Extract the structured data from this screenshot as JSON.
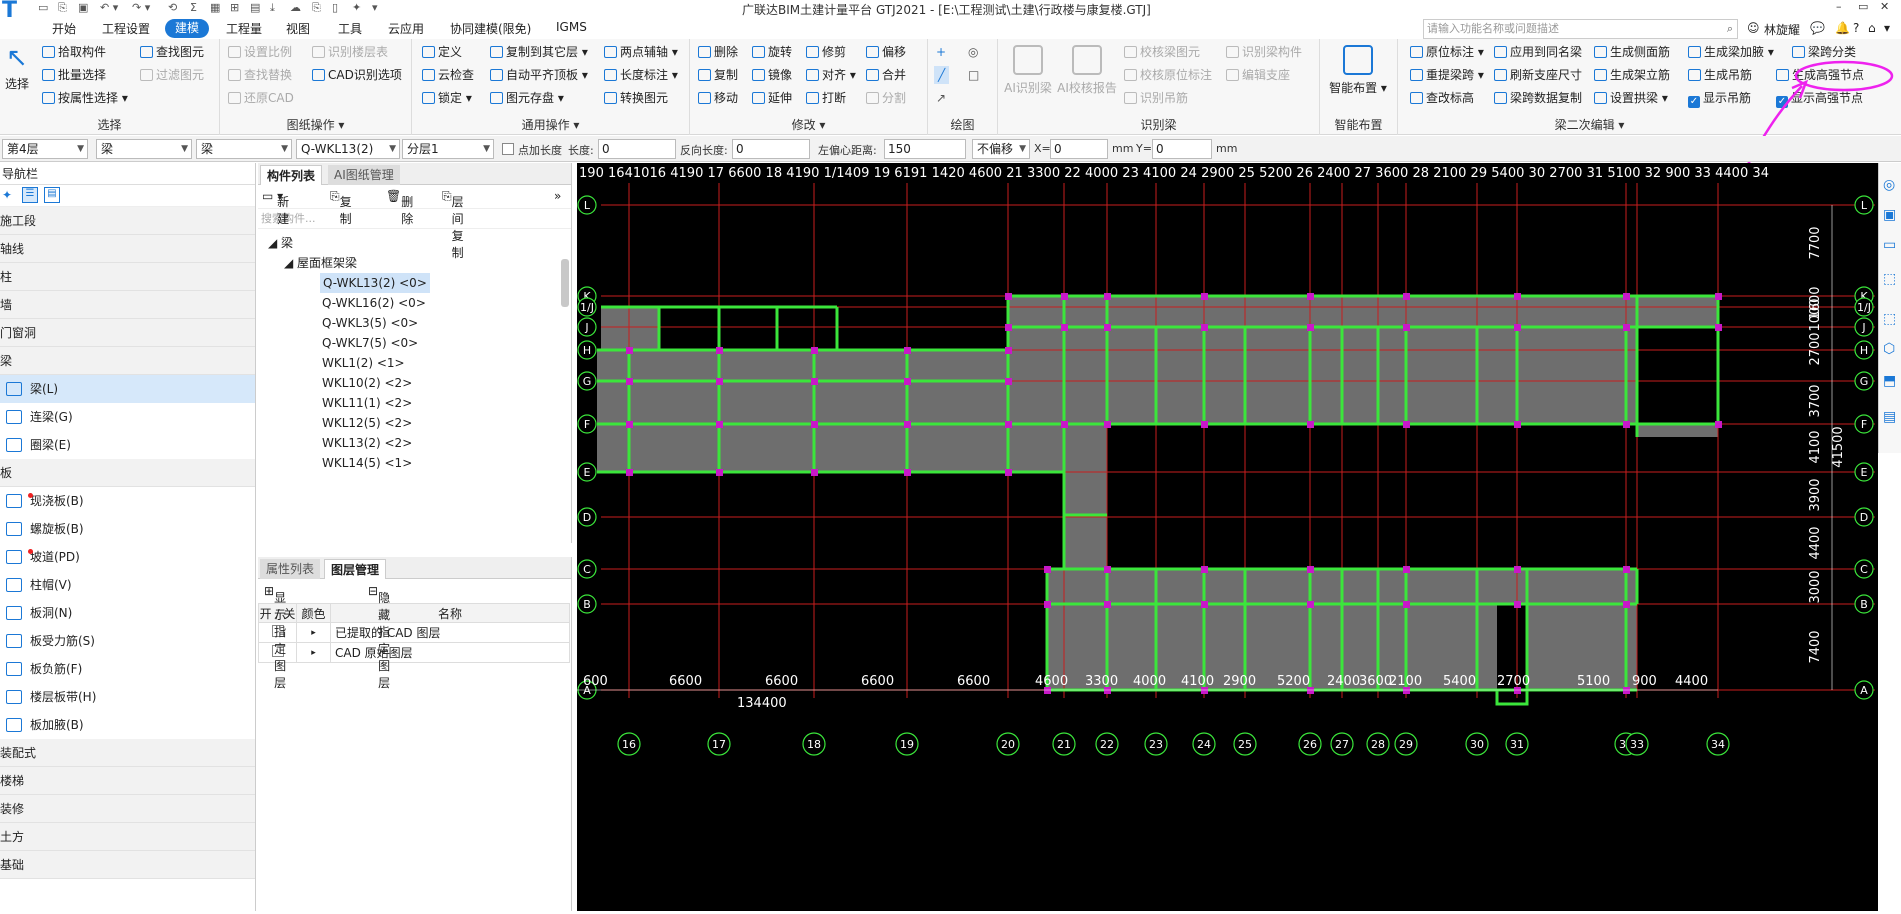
{
  "titlebar": {
    "title": "广联达BIM土建计量平台 GTJ2021 - [E:\\工程测试\\土建\\行政楼与康复楼.GTJ]",
    "logo": "T",
    "quick_access": [
      "↶",
      "↷",
      "Σ",
      "▭",
      "⊞",
      "▦",
      "⤓",
      "⎘"
    ],
    "win_controls": [
      "–",
      "▭",
      "✕"
    ]
  },
  "menubar": {
    "items": [
      "开始",
      "工程设置",
      "建模",
      "工程量",
      "视图",
      "工具",
      "云应用",
      "协同建模(限免)",
      "IGMS"
    ],
    "active": "建模",
    "search_placeholder": "请输入功能名称或问题描述",
    "user": "林旋耀",
    "right_icons": [
      "💬",
      "🔔",
      "?",
      "⌂",
      "▾"
    ]
  },
  "ribbon": {
    "groups": [
      {
        "title": "选择",
        "big": "选择",
        "buttons": [
          "拾取构件",
          "批量选择",
          "按属性选择",
          "查找图元",
          "过滤图元"
        ]
      },
      {
        "title": "图纸操作 ▾",
        "buttons": [
          "设置比例",
          "识别楼层表",
          "查找替换",
          "CAD识别选项",
          "还原CAD"
        ]
      },
      {
        "title": "通用操作 ▾",
        "buttons": [
          "定义",
          "复制到其它层",
          "两点辅轴",
          "云检查",
          "自动平齐顶板",
          "长度标注",
          "锁定",
          "图元存盘",
          "转换图元"
        ]
      },
      {
        "title": "修改 ▾",
        "buttons": [
          "删除",
          "旋转",
          "修剪",
          "偏移",
          "复制",
          "镜像",
          "对齐",
          "合并",
          "移动",
          "延伸",
          "打断",
          "分割"
        ]
      },
      {
        "title": "绘图",
        "buttons": [
          "+",
          "◎",
          "╱",
          "□",
          "↗"
        ]
      },
      {
        "title": "识别梁",
        "big_buttons": [
          "AI识别梁",
          "AI校核报告"
        ],
        "buttons": [
          "校核梁图元",
          "识别梁构件",
          "校核原位标注",
          "编辑支座",
          "识别吊筋"
        ]
      },
      {
        "title": "智能布置",
        "big": "智能布置"
      },
      {
        "title": "梁二次编辑 ▾",
        "buttons": [
          "原位标注",
          "应用到同名梁",
          "生成侧面筋",
          "生成梁加腋",
          "梁跨分类",
          "重提梁跨",
          "刷新支座尺寸",
          "生成架立筋",
          "生成吊筋",
          "生成高强节点",
          "查改标高",
          "梁跨数据复制",
          "设置拱梁",
          "显示吊筋",
          "显示高强节点"
        ]
      }
    ]
  },
  "toolrow": {
    "floor": "第4层",
    "type1": "梁",
    "type2": "梁",
    "component": "Q-WKL13(2)",
    "layer": "分层1",
    "point_length_label": "点加长度",
    "length_label": "长度:",
    "length_value": "0",
    "reverse_length_label": "反向长度:",
    "reverse_length_value": "0",
    "left_offset_label": "左偏心距离:",
    "left_offset_value": "150",
    "offset_mode": "不偏移",
    "x_label": "X=",
    "x_value": "0",
    "mm1": "mm",
    "y_label": "Y=",
    "y_value": "0",
    "mm2": "mm"
  },
  "nav": {
    "header": "导航栏",
    "categories_top": [
      "施工段",
      "轴线",
      "柱",
      "墙",
      "门窗洞"
    ],
    "beam_cat": "梁",
    "beam_items": [
      {
        "label": "梁(L)",
        "selected": true
      },
      {
        "label": "连梁(G)"
      },
      {
        "label": "圈梁(E)"
      }
    ],
    "slab_cat": "板",
    "slab_items": [
      {
        "label": "现浇板(B)",
        "dot": true
      },
      {
        "label": "螺旋板(B)"
      },
      {
        "label": "坡道(PD)",
        "dot": true
      },
      {
        "label": "柱帽(V)"
      },
      {
        "label": "板洞(N)"
      },
      {
        "label": "板受力筋(S)"
      },
      {
        "label": "板负筋(F)"
      },
      {
        "label": "楼层板带(H)"
      },
      {
        "label": "板加腋(B)"
      }
    ],
    "categories_bottom": [
      "装配式",
      "楼梯",
      "装修",
      "土方",
      "基础"
    ]
  },
  "components": {
    "tabs": [
      "构件列表",
      "AI图纸管理"
    ],
    "toolbar": [
      "新建",
      "复制",
      "删除",
      "层间复制"
    ],
    "search_placeholder": "搜索构件...",
    "root": "梁",
    "group": "屋面框架梁",
    "items": [
      "Q-WKL13(2) <0>",
      "Q-WKL16(2) <0>",
      "Q-WKL3(5) <0>",
      "Q-WKL7(5) <0>",
      "WKL1(2) <1>",
      "WKL10(2) <2>",
      "WKL11(1) <2>",
      "WKL12(5) <2>",
      "WKL13(2) <2>",
      "WKL14(5) <1>"
    ],
    "selected_index": 0
  },
  "layers": {
    "tabs": [
      "属性列表",
      "图层管理"
    ],
    "toolbar": [
      "显示指定图层",
      "隐藏指定图层"
    ],
    "columns": [
      "开 / 关",
      "颜色",
      "名称"
    ],
    "rows": [
      "已提取的 CAD 图层",
      "CAD 原始图层"
    ]
  },
  "drawing": {
    "bottom_dims": [
      "600",
      "6600",
      "6600",
      "6600",
      "6600",
      "4600",
      "3300",
      "4000",
      "4100",
      "2900",
      "5200",
      "2400",
      "3600",
      "2100",
      "5400",
      "2700",
      "5100",
      "900",
      "4400"
    ],
    "total_dim": "134400",
    "top_dims": [
      "190",
      "1641016",
      "4190",
      "17",
      "6600",
      "18",
      "4190",
      "1/1409",
      "19",
      "6191",
      "1420",
      "4600",
      "21",
      "3300",
      "22",
      "4000",
      "23",
      "4100",
      "24",
      "2900",
      "25",
      "5200",
      "26",
      "2400",
      "27",
      "3600",
      "28",
      "2100",
      "29",
      "5400",
      "30",
      "2700",
      "31",
      "5100",
      "32",
      "900",
      "33",
      "4400",
      "34"
    ],
    "x_axes": [
      "16",
      "17",
      "18",
      "19",
      "20",
      "21",
      "22",
      "23",
      "24",
      "25",
      "26",
      "27",
      "28",
      "29",
      "30",
      "31",
      "32",
      "33",
      "34"
    ],
    "y_axes": [
      "L",
      "K",
      "1/J",
      "J",
      "H",
      "G",
      "F",
      "E",
      "D",
      "C",
      "B",
      "A"
    ],
    "right_dims": [
      "7700",
      "1600",
      "1000",
      "2700",
      "3700",
      "4100",
      "3900",
      "4400",
      "3000",
      "7400"
    ],
    "right_total": "41500"
  },
  "colors": {
    "accent": "#1b78d6",
    "grid": "#c81e1e",
    "beam": "#3be63b",
    "fill": "#6e6e6e",
    "node": "#c819c8",
    "annotation": "#ee22ee"
  }
}
